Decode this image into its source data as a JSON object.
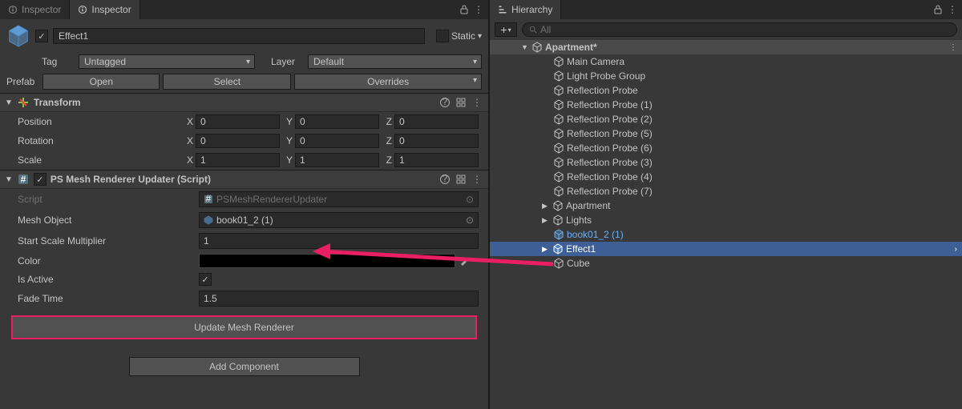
{
  "inspector": {
    "tab1": "Inspector",
    "tab2": "Inspector",
    "name": "Effect1",
    "static": "Static",
    "tagLabel": "Tag",
    "tagValue": "Untagged",
    "layerLabel": "Layer",
    "layerValue": "Default",
    "prefabLabel": "Prefab",
    "prefabOpen": "Open",
    "prefabSelect": "Select",
    "prefabOverrides": "Overrides"
  },
  "transform": {
    "title": "Transform",
    "posLabel": "Position",
    "rotLabel": "Rotation",
    "scaleLabel": "Scale",
    "x": "X",
    "y": "Y",
    "z": "Z",
    "posX": "0",
    "posY": "0",
    "posZ": "0",
    "rotX": "0",
    "rotY": "0",
    "rotZ": "0",
    "sclX": "1",
    "sclY": "1",
    "sclZ": "1"
  },
  "script": {
    "title": "PS Mesh Renderer Updater (Script)",
    "scriptLabel": "Script",
    "scriptValue": "PSMeshRendererUpdater",
    "meshLabel": "Mesh Object",
    "meshValue": "book01_2 (1)",
    "startScaleLabel": "Start Scale Multiplier",
    "startScaleValue": "1",
    "colorLabel": "Color",
    "isActiveLabel": "Is Active",
    "fadeTimeLabel": "Fade Time",
    "fadeTimeValue": "1.5",
    "updateBtn": "Update Mesh Renderer"
  },
  "addComponent": "Add Component",
  "hierarchy": {
    "tab": "Hierarchy",
    "searchPlaceholder": "All",
    "scene": "Apartment*",
    "items": [
      "Main Camera",
      "Light Probe Group",
      "Reflection Probe",
      "Reflection Probe (1)",
      "Reflection Probe (2)",
      "Reflection Probe (5)",
      "Reflection Probe (6)",
      "Reflection Probe (3)",
      "Reflection Probe (4)",
      "Reflection Probe (7)",
      "Apartment",
      "Lights",
      "book01_2 (1)",
      "Effect1",
      "Cube"
    ]
  }
}
